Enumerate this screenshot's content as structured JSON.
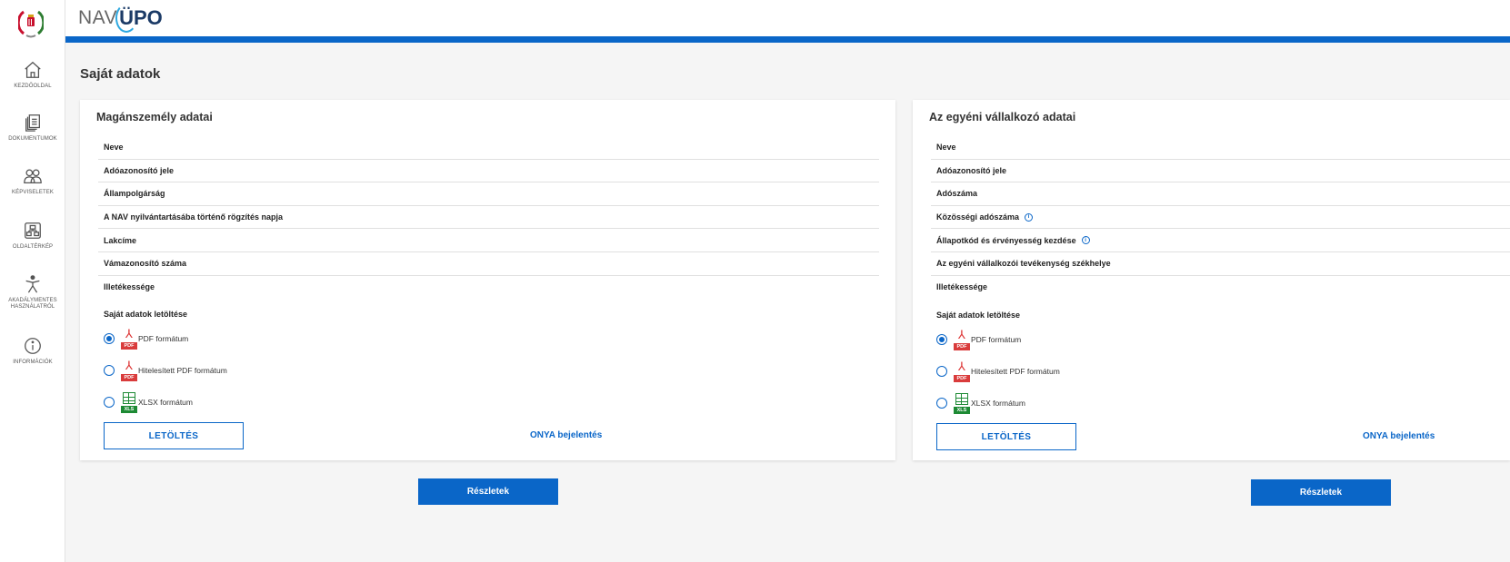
{
  "header": {
    "logo_nav": "NAV",
    "logo_upo": "ÜPO"
  },
  "sidebar": {
    "items": [
      {
        "label": "KEZDŐOLDAL",
        "icon": "home-icon"
      },
      {
        "label": "DOKUMENTUMOK",
        "icon": "documents-icon"
      },
      {
        "label": "KÉPVISELETEK",
        "icon": "people-icon"
      },
      {
        "label": "OLDALTÉRKÉP",
        "icon": "sitemap-icon"
      },
      {
        "label": "AKADÁLYMENTES HASZNÁLATRÓL",
        "icon": "accessibility-icon"
      },
      {
        "label": "INFORMÁCIÓK",
        "icon": "info-icon"
      }
    ]
  },
  "page_title": "Saját adatok",
  "left_card": {
    "title": "Magánszemély adatai",
    "rows": [
      "Neve",
      "Adóazonosító jele",
      "Állampolgárság",
      "A NAV nyilvántartásába történő rögzítés napja",
      "Lakcíme",
      "Vámazonosító száma",
      "Illetékessége"
    ],
    "download_title": "Saját adatok letöltése",
    "options": [
      {
        "label": "PDF formátum",
        "tag": "PDF",
        "checked": true
      },
      {
        "label": "Hitelesített PDF formátum",
        "tag": "PDF",
        "checked": false
      },
      {
        "label": "XLSX formátum",
        "tag": "XLS",
        "checked": false
      }
    ],
    "download_button": "LETÖLTÉS",
    "onya_link": "ONYA bejelentés",
    "details_button": "Részletek"
  },
  "right_card": {
    "title": "Az egyéni vállalkozó adatai",
    "rows": [
      {
        "label": "Neve",
        "info": false
      },
      {
        "label": "Adóazonosító jele",
        "info": false
      },
      {
        "label": "Adószáma",
        "info": false
      },
      {
        "label": "Közösségi adószáma",
        "info": true
      },
      {
        "label": "Állapotkód és érvényesség kezdése",
        "info": true
      },
      {
        "label": "Az egyéni vállalkozói tevékenység székhelye",
        "info": false
      },
      {
        "label": "Illetékessége",
        "info": false
      }
    ],
    "download_title": "Saját adatok letöltése",
    "options": [
      {
        "label": "PDF formátum",
        "tag": "PDF",
        "checked": true
      },
      {
        "label": "Hitelesített PDF formátum",
        "tag": "PDF",
        "checked": false
      },
      {
        "label": "XLSX formátum",
        "tag": "XLS",
        "checked": false
      }
    ],
    "download_button": "LETÖLTÉS",
    "onya_link": "ONYA bejelentés",
    "details_button": "Részletek"
  },
  "info_glyph": "i",
  "colors": {
    "primary": "#0a66c8",
    "pdf": "#d93b3b",
    "xls": "#1d8a34"
  }
}
